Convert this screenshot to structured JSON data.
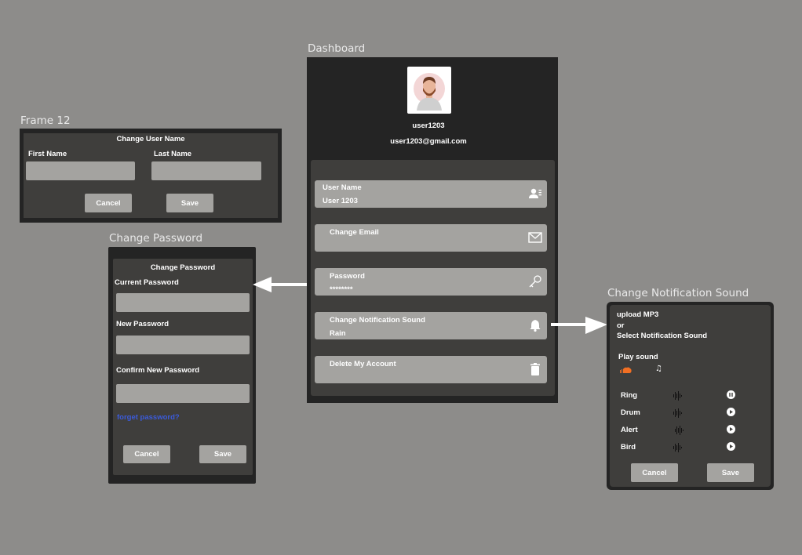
{
  "frames": {
    "frame12_label": "Frame 12",
    "change_password_label": "Change Password",
    "dashboard_label": "Dashboard",
    "notification_label": "Change Notification Sound"
  },
  "frame12": {
    "title": "Change User Name",
    "first_name_label": "First Name",
    "last_name_label": "Last Name",
    "cancel": "Cancel",
    "save": "Save"
  },
  "change_password": {
    "title": "Change Password",
    "current_label": "Current Password",
    "new_label": "New Password",
    "confirm_label": "Confirm New Password",
    "forget_link": "forget password?",
    "cancel": "Cancel",
    "save": "Save"
  },
  "dashboard": {
    "username": "user1203",
    "email": "user1203@gmail.com",
    "cards": [
      {
        "label": "User Name",
        "value": "User 1203",
        "icon": "user-card-icon"
      },
      {
        "label": "Change Email",
        "value": "",
        "icon": "mail-icon"
      },
      {
        "label": "Password",
        "value": "********",
        "icon": "key-icon"
      },
      {
        "label": "Change Notification Sound",
        "value": "Rain",
        "icon": "bell-icon"
      },
      {
        "label": "Delete My Account",
        "value": "",
        "icon": "trash-icon"
      }
    ]
  },
  "notification": {
    "upload_line": "upload  MP3",
    "or_line": " or",
    "select_line": "Select Notification Sound",
    "play_sound": "Play sound",
    "sounds": [
      {
        "name": "Ring",
        "state": "pause"
      },
      {
        "name": "Drum",
        "state": "play"
      },
      {
        "name": "Alert",
        "state": "play"
      },
      {
        "name": "Bird",
        "state": "play"
      }
    ],
    "cancel": "Cancel",
    "save": "Save"
  },
  "colors": {
    "background": "#8d8c8a",
    "frame_dark": "#242424",
    "panel": "#3f3e3c",
    "field": "#a4a3a0",
    "link": "#3b5bdb",
    "soundcloud": "#f26f23"
  }
}
